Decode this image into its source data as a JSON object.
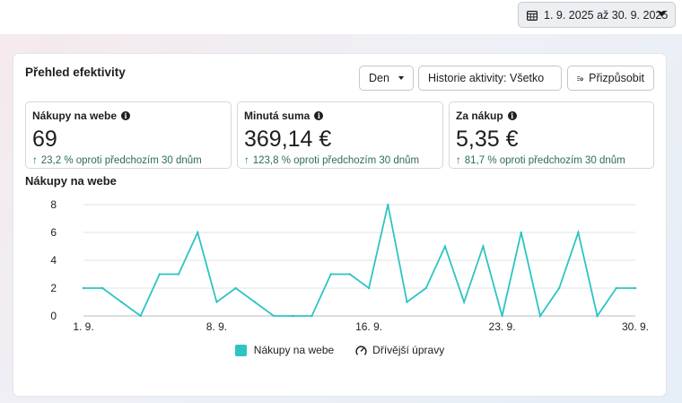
{
  "header": {
    "date_range": "1. 9. 2025 až 30. 9. 2025"
  },
  "panel": {
    "title": "Přehled efektivity",
    "controls": {
      "granularity": "Den",
      "history": "Historie aktivity: Všetko",
      "customize": "Přizpůsobit"
    }
  },
  "metrics": [
    {
      "label": "Nákupy na webe",
      "value": "69",
      "change": "23,2 % oproti předchozím 30 dnům"
    },
    {
      "label": "Minutá suma",
      "value": "369,14 €",
      "change": "123,8 % oproti předchozím 30 dnům"
    },
    {
      "label": "Za nákup",
      "value": "5,35 €",
      "change": "81,7 % oproti předchozím 30 dnům"
    }
  ],
  "chart_title": "Nákupy na webe",
  "legend": {
    "series": "Nákupy na webe",
    "previous": "Dřívější úpravy"
  },
  "colors": {
    "series": "#2ec4c4",
    "positive": "#2d6e4e"
  },
  "chart_data": {
    "type": "line",
    "x": [
      1,
      2,
      3,
      4,
      5,
      6,
      7,
      8,
      9,
      10,
      11,
      12,
      13,
      14,
      15,
      16,
      17,
      18,
      19,
      20,
      21,
      22,
      23,
      24,
      25,
      26,
      27,
      28,
      29,
      30
    ],
    "x_tick_labels": [
      "1. 9.",
      "8. 9.",
      "16. 9.",
      "23. 9.",
      "30. 9."
    ],
    "x_tick_values": [
      1,
      8,
      16,
      23,
      30
    ],
    "series": [
      {
        "name": "Nákupy na webe",
        "values": [
          2,
          2,
          1,
          0,
          3,
          3,
          6,
          1,
          2,
          1,
          0,
          0,
          0,
          3,
          3,
          2,
          8,
          1,
          2,
          5,
          1,
          5,
          0,
          6,
          0,
          2,
          6,
          0,
          2,
          2
        ]
      }
    ],
    "yticks": [
      0,
      2,
      4,
      6,
      8
    ],
    "ylim": [
      0,
      8
    ],
    "grid": true,
    "legend_position": "bottom"
  }
}
